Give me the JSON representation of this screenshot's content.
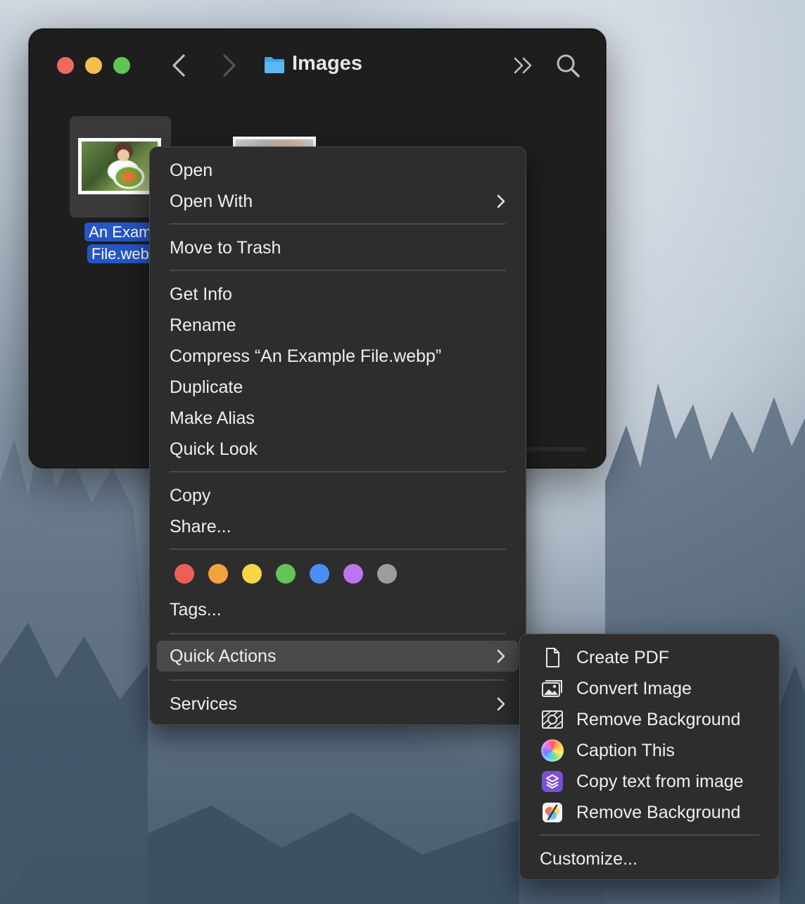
{
  "window": {
    "title": "Images",
    "file_name": "An Example File.webp",
    "file_label_line1": "An Examp",
    "file_label_line2": "File.webp"
  },
  "context_menu": {
    "open": "Open",
    "open_with": "Open With",
    "move_to_trash": "Move to Trash",
    "get_info": "Get Info",
    "rename": "Rename",
    "compress": "Compress “An Example File.webp”",
    "duplicate": "Duplicate",
    "make_alias": "Make Alias",
    "quick_look": "Quick Look",
    "copy": "Copy",
    "share": "Share...",
    "tags": "Tags...",
    "quick_actions": "Quick Actions",
    "services": "Services",
    "tag_colors": [
      "#ec5f58",
      "#f4a23e",
      "#f7d645",
      "#62c554",
      "#4a8ef5",
      "#bc75f0",
      "#9d9d9f"
    ]
  },
  "quick_actions_menu": {
    "items": [
      {
        "label": "Create PDF",
        "icon": "document-icon"
      },
      {
        "label": "Convert Image",
        "icon": "convert-image-icon"
      },
      {
        "label": "Remove Background",
        "icon": "remove-background-icon"
      },
      {
        "label": "Caption This",
        "icon": "color-wheel-icon"
      },
      {
        "label": "Copy text from image",
        "icon": "shortcuts-icon"
      },
      {
        "label": "Remove Background",
        "icon": "pixelmator-icon"
      }
    ],
    "customize": "Customize..."
  }
}
